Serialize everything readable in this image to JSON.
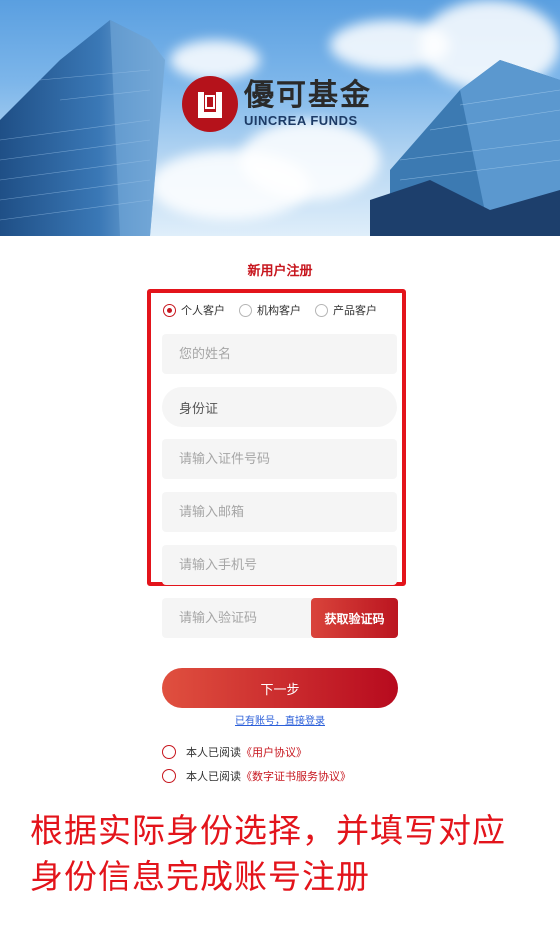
{
  "brand": {
    "name_cn": "優可基金",
    "name_en": "UINCREA FUNDS",
    "color": "#b5121b"
  },
  "form": {
    "title": "新用户注册",
    "customer_types": [
      {
        "label": "个人客户",
        "checked": true
      },
      {
        "label": "机构客户",
        "checked": false
      },
      {
        "label": "产品客户",
        "checked": false
      }
    ],
    "name_placeholder": "您的姓名",
    "id_type_value": "身份证",
    "id_number_placeholder": "请输入证件号码",
    "email_placeholder": "请输入邮箱",
    "phone_placeholder": "请输入手机号",
    "code_placeholder": "请输入验证码",
    "get_code_label": "获取验证码",
    "next_label": "下一步",
    "login_link": "已有账号，直接登录",
    "agreements": [
      {
        "prefix": "本人已阅读",
        "link": "《用户协议》"
      },
      {
        "prefix": "本人已阅读",
        "link": "《数字证书服务协议》"
      }
    ]
  },
  "caption": {
    "line1": "根据实际身份选择，并填写对应",
    "line2": "身份信息完成账号注册"
  },
  "colors": {
    "accent": "#c7161e",
    "highlight": "#e3141b",
    "link": "#2b5fd9",
    "field_bg": "#f5f5f5"
  }
}
